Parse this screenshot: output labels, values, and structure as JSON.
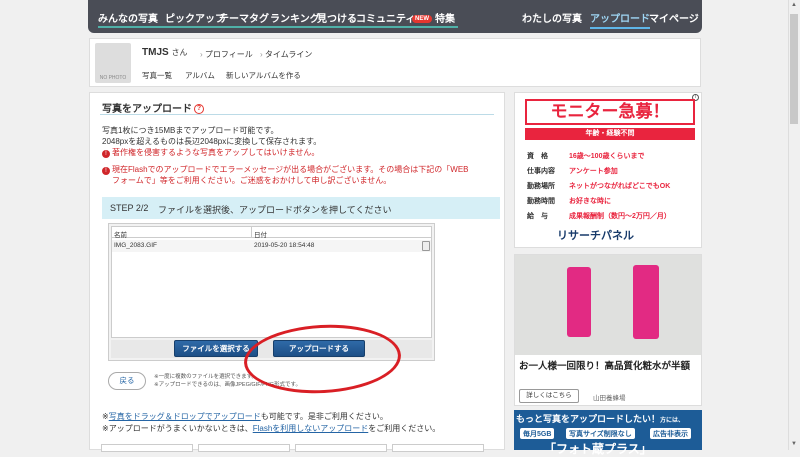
{
  "nav": {
    "items": [
      "みんなの写真",
      "ピックアップ",
      "テーマタグ",
      "ランキング",
      "見つける",
      "コミュニティ"
    ],
    "new_badge": "NEW",
    "feature": "特集",
    "right": [
      "わたしの写真",
      "アップロード",
      "マイページ"
    ]
  },
  "profile": {
    "avatar_label": "NO PHOTO",
    "username": "TMJS",
    "honorific": "さん",
    "links": [
      "プロフィール",
      "タイムライン"
    ],
    "subnav": [
      "写真一覧",
      "アルバム",
      "新しいアルバムを作る"
    ]
  },
  "main": {
    "title": "写真をアップロード",
    "help": "?",
    "info1": "写真1枚につき15MBまでアップロード可能です。",
    "info2": "2048pxを超えるものは長辺2048pxに変換して保存されます。",
    "warn1": "著作権を侵害するような写真をアップしてはいけません。",
    "warn2a": "現在Flashでのアップロードでエラーメッセージが出る場合がございます。その場合は下記の「WEB",
    "warn2b": "フォームで」等をご利用ください。ご迷惑をおかけして申し訳ございません。",
    "step_label": "STEP 2/2",
    "step_text": "ファイルを選択後、アップロードボタンを押してください",
    "table": {
      "col_name": "名前",
      "col_date": "日付",
      "file_name": "IMG_2083.GIF",
      "file_date": "2019-05-20 18:54:48"
    },
    "select_button": "ファイルを選択する",
    "upload_button": "アップロードする",
    "back_button": "戻る",
    "note1": "※一度に複数のファイルを選択できます。",
    "note2": "※アップロードできるのは、画像JPEG/GIF/PNG形式です。",
    "bottom1_pre": "※",
    "bottom1_link": "写真をドラッグ＆ドロップでアップロード",
    "bottom1_post": "も可能です。是非ご利用ください。",
    "bottom2_pre": "※アップロードがうまくいかないときは、",
    "bottom2_link": "Flashを利用しないアップロード",
    "bottom2_post": "をご利用ください。"
  },
  "ad1": {
    "title": "モニター急募！",
    "sub": "年齢・経験不問",
    "rows": [
      {
        "k": "資　格",
        "v": "16歳～100歳くらいまで"
      },
      {
        "k": "仕事内容",
        "v": "アンケート参加"
      },
      {
        "k": "勤務場所",
        "v": "ネットがつながればどこでもOK"
      },
      {
        "k": "勤務時間",
        "v": "お好きな時に"
      },
      {
        "k": "給　与",
        "v": "成果報酬制（数円～2万円／月）"
      }
    ],
    "logo": "リサーチパネル"
  },
  "ad2": {
    "text": "お一人様一回限り！高品質化粧水が半額",
    "button": "詳しくはこちら",
    "brand": "山田養蜂場"
  },
  "ad3": {
    "title": "もっと写真をアップロードしたい！",
    "title_small": "方には、",
    "chips": [
      "毎月5GB",
      "写真サイズ制限なし",
      "広告非表示"
    ],
    "big": "「フォト蔵プラス」"
  },
  "colors": {
    "nav_bg": "#4a4d56",
    "accent_red": "#e9243e",
    "button_blue": "#1d4f86",
    "annotation_red": "#d91f25"
  }
}
